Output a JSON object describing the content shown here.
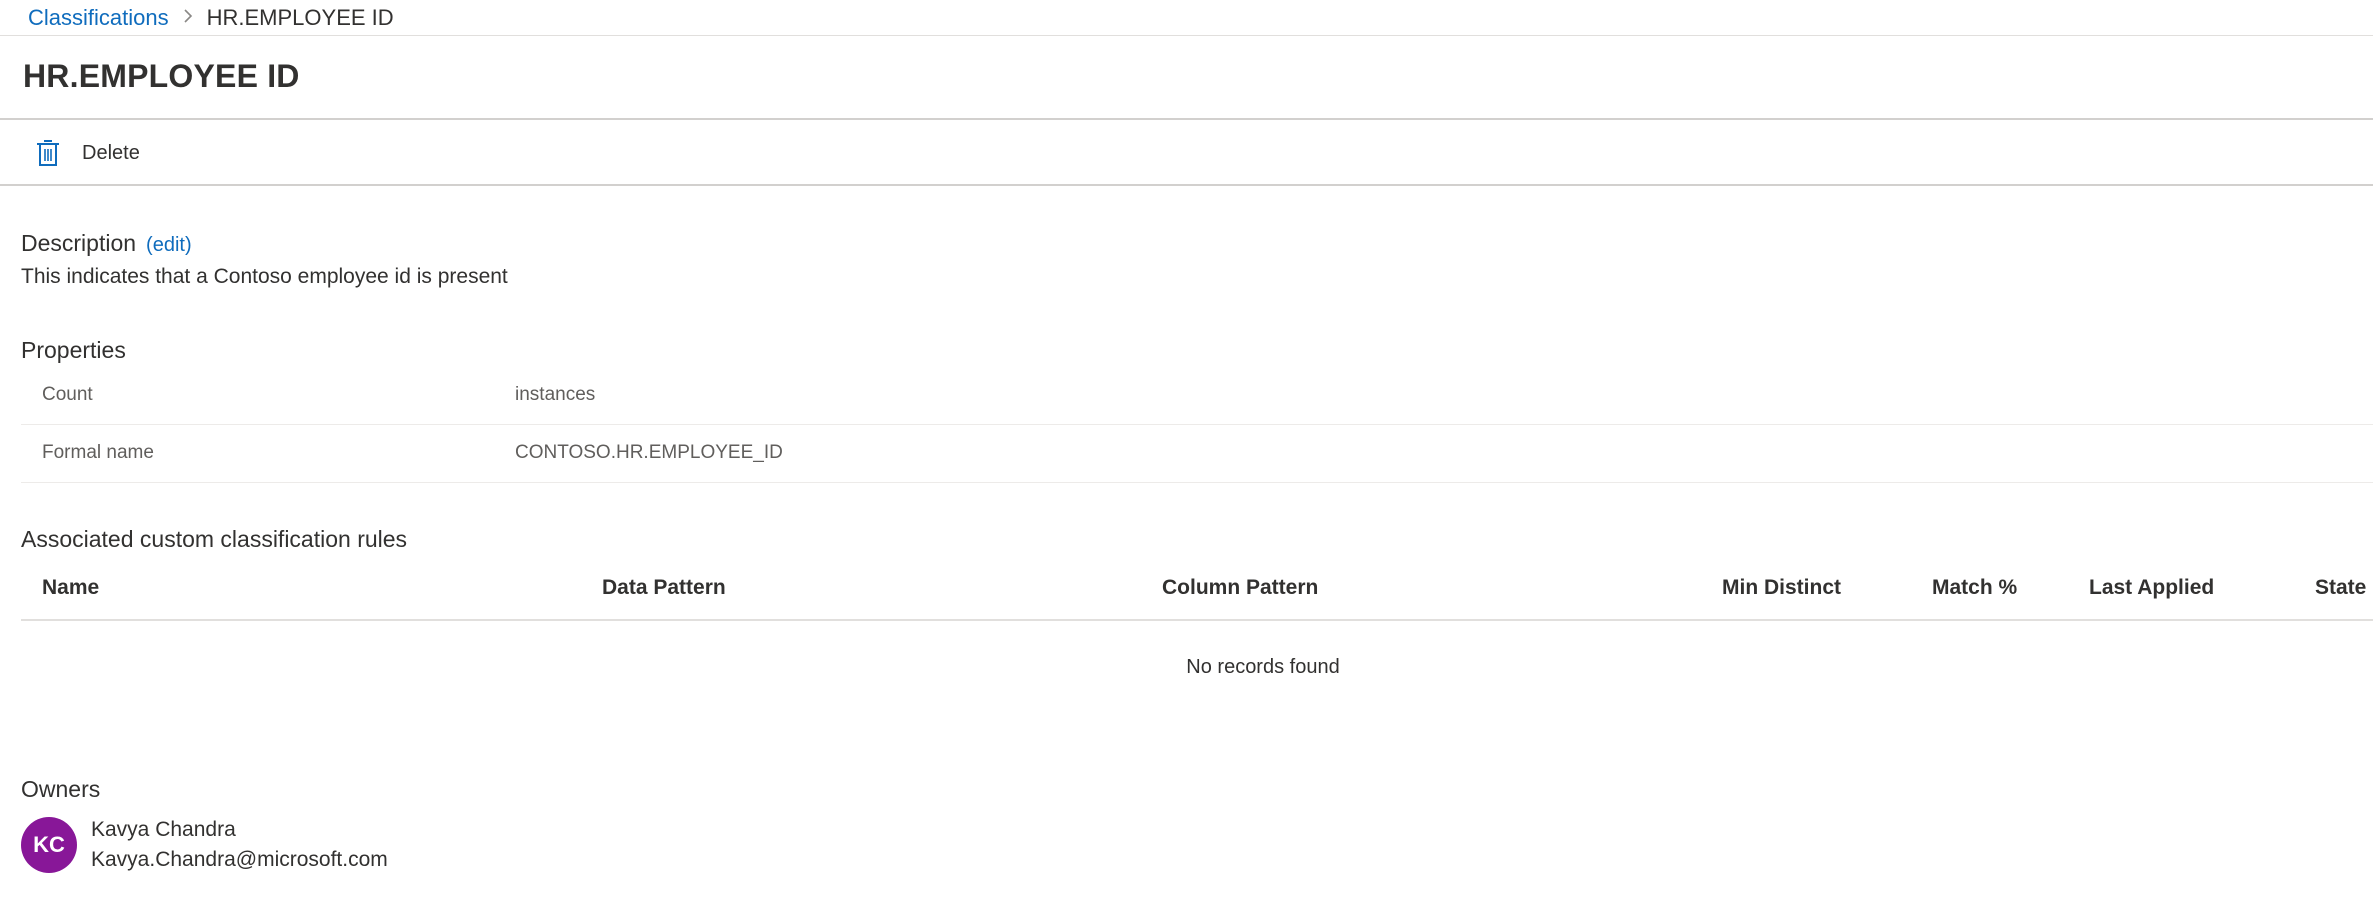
{
  "breadcrumb": {
    "parent": "Classifications",
    "separator": ">",
    "current": "HR.EMPLOYEE ID"
  },
  "page": {
    "title": "HR.EMPLOYEE ID"
  },
  "toolbar": {
    "delete_label": "Delete",
    "delete_icon": "trash-icon",
    "accent": "#0f6cbd"
  },
  "description": {
    "heading": "Description",
    "edit_label": "(edit)",
    "text": "This indicates that a Contoso employee id is present"
  },
  "properties": {
    "heading": "Properties",
    "rows": [
      {
        "key": "Count",
        "value": "instances"
      },
      {
        "key": "Formal name",
        "value": "CONTOSO.HR.EMPLOYEE_ID"
      }
    ]
  },
  "rules": {
    "heading": "Associated custom classification rules",
    "columns": [
      "Name",
      "Data Pattern",
      "Column Pattern",
      "Min Distinct",
      "Match %",
      "Last Applied",
      "State"
    ],
    "empty_text": "No records found"
  },
  "owners": {
    "heading": "Owners",
    "list": [
      {
        "initials": "KC",
        "name": "Kavya Chandra",
        "email": "Kavya.Chandra@microsoft.com",
        "avatar_color": "#881798"
      }
    ]
  }
}
